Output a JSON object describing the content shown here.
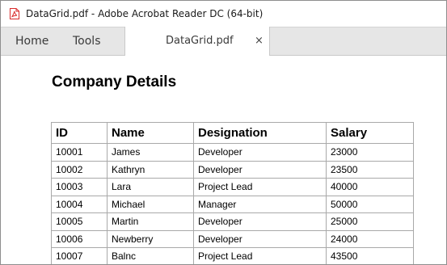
{
  "window": {
    "title": "DataGrid.pdf - Adobe Acrobat Reader DC (64-bit)",
    "icon": "acrobat-pdf-icon"
  },
  "tabs": {
    "home_label": "Home",
    "tools_label": "Tools",
    "document_label": "DataGrid.pdf",
    "close_glyph": "×"
  },
  "document": {
    "heading": "Company Details",
    "table": {
      "headers": [
        "ID",
        "Name",
        "Designation",
        "Salary"
      ],
      "rows": [
        [
          "10001",
          "James",
          "Developer",
          "23000"
        ],
        [
          "10002",
          "Kathryn",
          "Developer",
          "23500"
        ],
        [
          "10003",
          "Lara",
          "Project Lead",
          "40000"
        ],
        [
          "10004",
          "Michael",
          "Manager",
          "50000"
        ],
        [
          "10005",
          "Martin",
          "Developer",
          "25000"
        ],
        [
          "10006",
          "Newberry",
          "Developer",
          "24000"
        ],
        [
          "10007",
          "Balnc",
          "Project Lead",
          "43500"
        ]
      ]
    }
  },
  "colors": {
    "accent_red": "#d92b2b",
    "tabbar_bg": "#e6e6e6",
    "border": "#a9a9a9"
  }
}
